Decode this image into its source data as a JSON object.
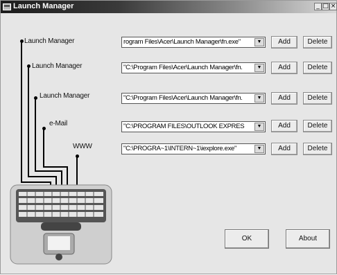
{
  "window": {
    "title": "Launch Manager"
  },
  "titlebar_buttons": {
    "minimize": "_",
    "maximize": "□",
    "close": "×"
  },
  "rows": [
    {
      "label": "Launch Manager",
      "path": "rogram Files\\Acer\\Launch Manager\\fn.exe\""
    },
    {
      "label": "Launch Manager",
      "path": "\"C:\\Program Files\\Acer\\Launch Manager\\fn."
    },
    {
      "label": "Launch Manager",
      "path": "\"C:\\Program Files\\Acer\\Launch Manager\\fn."
    },
    {
      "label": "e-Mail",
      "path": "\"C:\\PROGRAM FILES\\OUTLOOK EXPRES"
    },
    {
      "label": "WWW",
      "path": "\"C:\\PROGRA~1\\INTERN~1\\iexplore.exe\""
    }
  ],
  "add_label": "Add",
  "delete_label": "Delete",
  "dropdown_glyph": "▼",
  "ok_label": "OK",
  "about_label": "About",
  "icons": [
    "app-icon",
    "dropdown-arrow-icon",
    "keyboard-image"
  ],
  "colors": {
    "titlebar_dark": "#1c1c1c",
    "window_bg": "#e6e6e6"
  }
}
